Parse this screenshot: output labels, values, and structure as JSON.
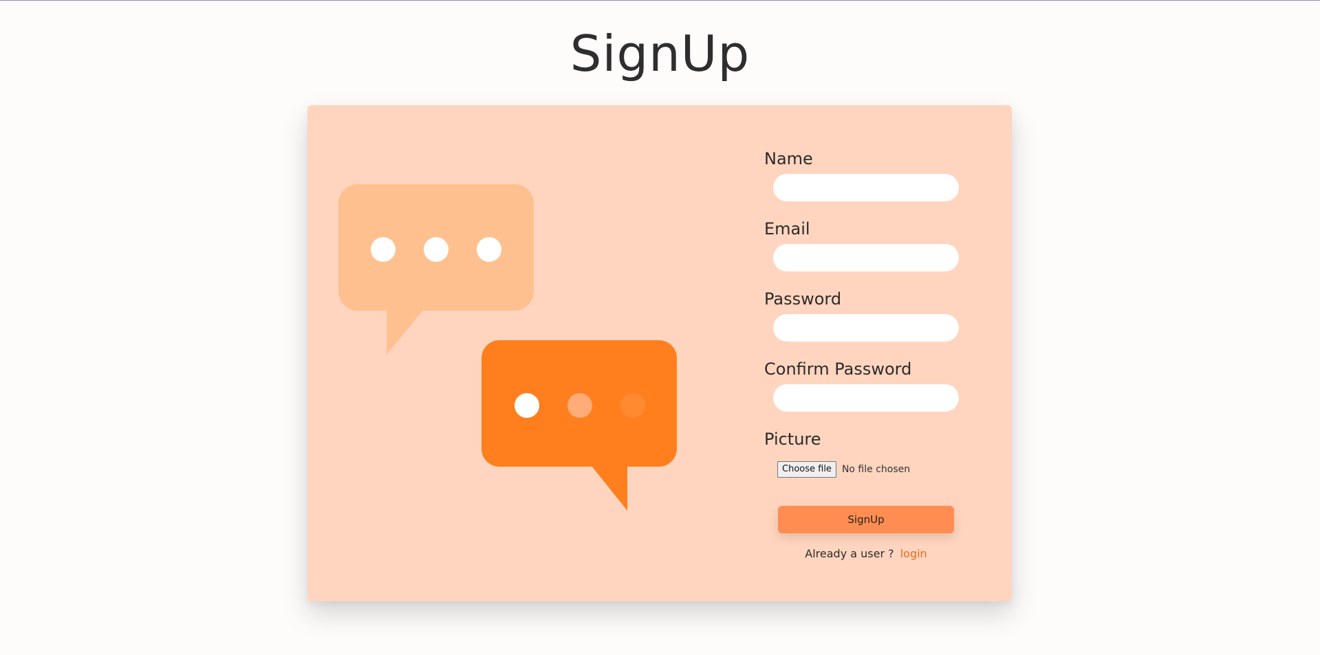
{
  "page": {
    "title": "SignUp"
  },
  "colors": {
    "background": "#fdfcfb",
    "card": "#ffd5bf",
    "bubble_light": "#ffc08f",
    "bubble_dark": "#ff7f1e",
    "button": "#ff8d52",
    "link": "#e86a1d"
  },
  "illustration": {
    "icon": "chat-bubbles-icon"
  },
  "form": {
    "fields": [
      {
        "label": "Name",
        "value": "",
        "placeholder": ""
      },
      {
        "label": "Email",
        "value": "",
        "placeholder": ""
      },
      {
        "label": "Password",
        "value": "",
        "placeholder": ""
      },
      {
        "label": "Confirm Password",
        "value": "",
        "placeholder": ""
      }
    ],
    "picture": {
      "label": "Picture",
      "button_label": "Choose file",
      "status": "No file chosen"
    },
    "submit_label": "SignUp",
    "login_prompt": "Already a user ?",
    "login_link": "login"
  }
}
